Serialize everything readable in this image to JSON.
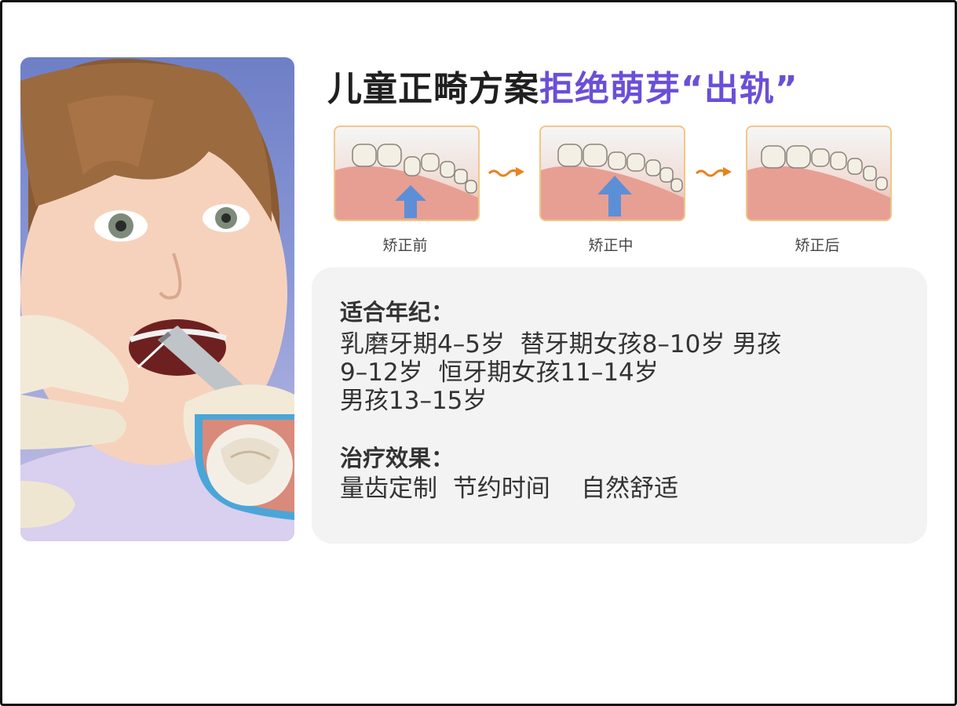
{
  "title": {
    "dark": "儿童正畸方案",
    "accent": "拒绝萌芽“出轨”"
  },
  "colors": {
    "title_dark": "#1f1f1f",
    "title_accent": "#6a4fd8",
    "connector_arrow": "#e8821e",
    "stage_border": "#f0c78a",
    "panel_bg": "#f3f3f3",
    "body_text": "#333333"
  },
  "stages": [
    {
      "label": "矫正前",
      "icon": "teeth-before-icon"
    },
    {
      "label": "矫正中",
      "icon": "teeth-during-icon"
    },
    {
      "label": "矫正后",
      "icon": "teeth-after-icon"
    }
  ],
  "photo": {
    "icon": "child-dental-photo",
    "inset_icon": "tooth-closeup-icon"
  },
  "info": {
    "age": {
      "heading": "适合年纪：",
      "lines": [
        "乳磨牙期4–5岁  替牙期女孩8–10岁 男孩",
        "9–12岁  恒牙期女孩11–14岁",
        "男孩13–15岁"
      ]
    },
    "effect": {
      "heading": "治疗效果：",
      "line": "量齿定制  节约时间    自然舒适"
    }
  }
}
